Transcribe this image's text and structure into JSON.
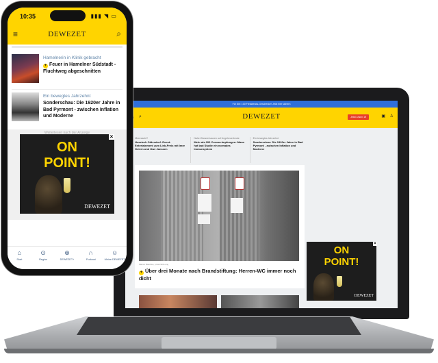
{
  "laptop": {
    "banner": "Für Sie: 100 Freiabends-Geschenke! Jetzt hier sichern",
    "logo": "DEWEZET",
    "cta": "Jetzt Lesen 1€",
    "teasers": [
      {
        "kicker": "Überrascht?",
        "title": "Hessisch Oldendorf: Event-Entertainment zum Lieb-Preis mit Imre Geiern und Uwe Janssen"
      },
      {
        "kicker": "Nahe Wanzenhausen auf Ungeheuerbeute",
        "title": "Mehr als 200 Corona-Impfungen: Mann hat laut Studie ein normales Immunsystem"
      },
      {
        "kicker": "Ein bewegtes Jahrzehnt",
        "title": "Sonderschau: Die 1920er Jahre in Bad Pyrmont - zwischen Inflation und Moderne"
      }
    ],
    "main_article": {
      "credit": "Marion Baschke, privat Wil-Lung",
      "headline": "Über drei Monate nach Brandstiftung: Herren-WC immer noch dicht"
    },
    "ad": {
      "title_line1": "ON",
      "title_line2": "POINT!",
      "brand": "DEWEZET",
      "close": "×"
    }
  },
  "phone": {
    "time": "10:35",
    "signal": "▮▮▮ ◥ ▭",
    "logo": "DEWEZET",
    "articles": [
      {
        "kicker": "Hamelnerin in Klinik gebracht",
        "title": "Feuer in Hamelner Südstadt - Fluchtweg abgeschnitten"
      },
      {
        "kicker": "Ein bewegtes Jahrzehnt",
        "title": "Sonderschau: Die 1920er Jahre in Bad Pyrmont - zwischen Inflation und Moderne"
      }
    ],
    "ad_note": "Weiterlesen nach der Anzeige",
    "ad": {
      "title_line1": "ON",
      "title_line2": "POINT!",
      "brand": "DEWEZET",
      "close": "×"
    },
    "tabs": [
      {
        "icon": "⌂",
        "label": "Start"
      },
      {
        "icon": "⊙",
        "label": "Region"
      },
      {
        "icon": "⊕",
        "label": "DEWEZET+"
      },
      {
        "icon": "∩",
        "label": "Podcast"
      },
      {
        "icon": "☺",
        "label": "Meine DEWEZET"
      }
    ]
  },
  "colors": {
    "brand_yellow": "#ffd400",
    "accent_red": "#e8402a",
    "link_blue": "#5f84a8",
    "tab_blue": "#3b5a80"
  }
}
